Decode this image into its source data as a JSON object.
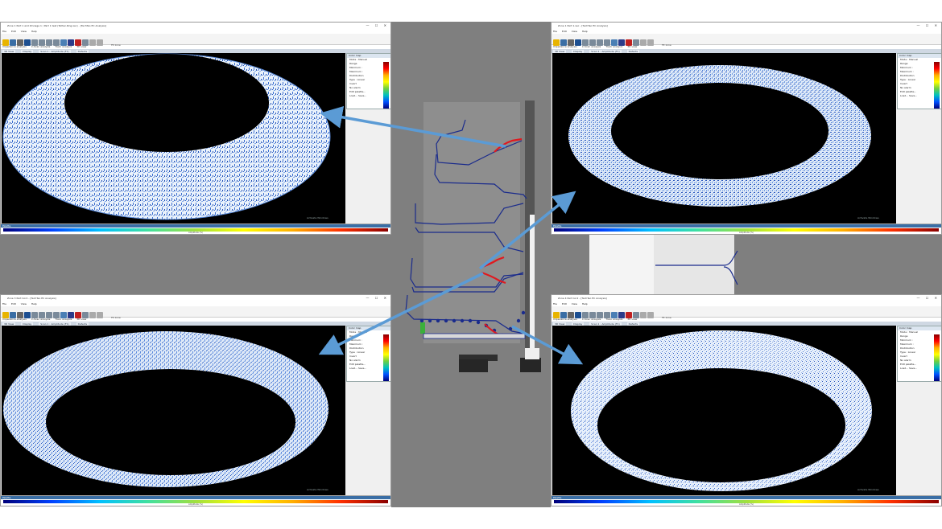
{
  "windows": [
    {
      "id": "top-left",
      "title": "Zone 1 Part 1 and Zinnage 1 / Part 1 test (Tether-Ring.xec) - [TechTeo EC Analysis]",
      "menu": [
        "File",
        "Edit",
        "View",
        "Help"
      ],
      "toolbar_zoom_label": "Fit zone",
      "tabs_analysis": [
        "Impedance analysis",
        "C-Scan analysis",
        "Track analysis",
        "3D view"
      ],
      "tabs_view": [
        "3D View",
        "Display",
        "Scan 1 : Amplitude (F1)",
        "Defects"
      ],
      "palette_label": "Palette",
      "palette_axis": "Amplitude (%)",
      "watermark": "Activate Windows"
    },
    {
      "id": "top-right",
      "title": "Zone 1 Part 1.xec - [TechTeo EC Analysis]",
      "menu": [
        "File",
        "Edit",
        "View",
        "Help"
      ],
      "toolbar_zoom_label": "Fit zone",
      "tabs_analysis": [
        "Impedance analysis",
        "C-Scan analysis",
        "Track analysis",
        "3D view"
      ],
      "tabs_view": [
        "3D View",
        "Display",
        "Scan 1 : Amplitude (F1)",
        "Defects"
      ],
      "palette_label": "Palette",
      "palette_axis": "Amplitude (%)",
      "watermark": "Activate Windows"
    },
    {
      "id": "bottom-left",
      "title": "Zone 3 Part Cor2 - [TechTeo EC Analysis]",
      "menu": [
        "File",
        "Edit",
        "View",
        "Help"
      ],
      "toolbar_zoom_label": "Fit zone",
      "tabs_analysis": [
        "Impedance analysis",
        "C-Scan analysis",
        "Track analysis",
        "3D view"
      ],
      "tabs_view": [
        "3D View",
        "Display",
        "Scan 1 : Amplitude (F1)",
        "Defects"
      ],
      "palette_label": "Palette",
      "palette_axis": "Amplitude (%)",
      "watermark": "Activate Windows"
    },
    {
      "id": "bottom-right",
      "title": "Zone 4 Part Cor2 - [TechTeo EC Analysis]",
      "menu": [
        "File",
        "Edit",
        "View",
        "Help"
      ],
      "toolbar_zoom_label": "Fit zone",
      "tabs_analysis": [
        "Impedance analysis",
        "C-Scan analysis",
        "Track analysis",
        "3D view"
      ],
      "tabs_view": [
        "3D View",
        "Display",
        "Scan 1 : Amplitude (F1)",
        "Defects"
      ],
      "palette_label": "Palette",
      "palette_axis": "Amplitude (%)",
      "watermark": "Activate Windows"
    }
  ],
  "color_map_panel": {
    "header": "Color map",
    "mode_label": "Mode :",
    "mode_value": "Manual",
    "range_label": "Range",
    "minimum_label": "Minimum :",
    "maximum_label": "Maximum :",
    "distribution_label": "Distribution",
    "type_label": "Type :",
    "type_value": "Linear",
    "invert_label": "Invert",
    "no_alarm_label": "No alarm",
    "edit_palette_button": "Edit palette...",
    "load_button": "Load...",
    "save_button": "Save..."
  },
  "colors": {
    "highlight_red": "#e0191f",
    "profile_blue": "#1a2b8c",
    "arrow_blue": "#5b9bd5",
    "background_gray": "#7f7f7f"
  }
}
